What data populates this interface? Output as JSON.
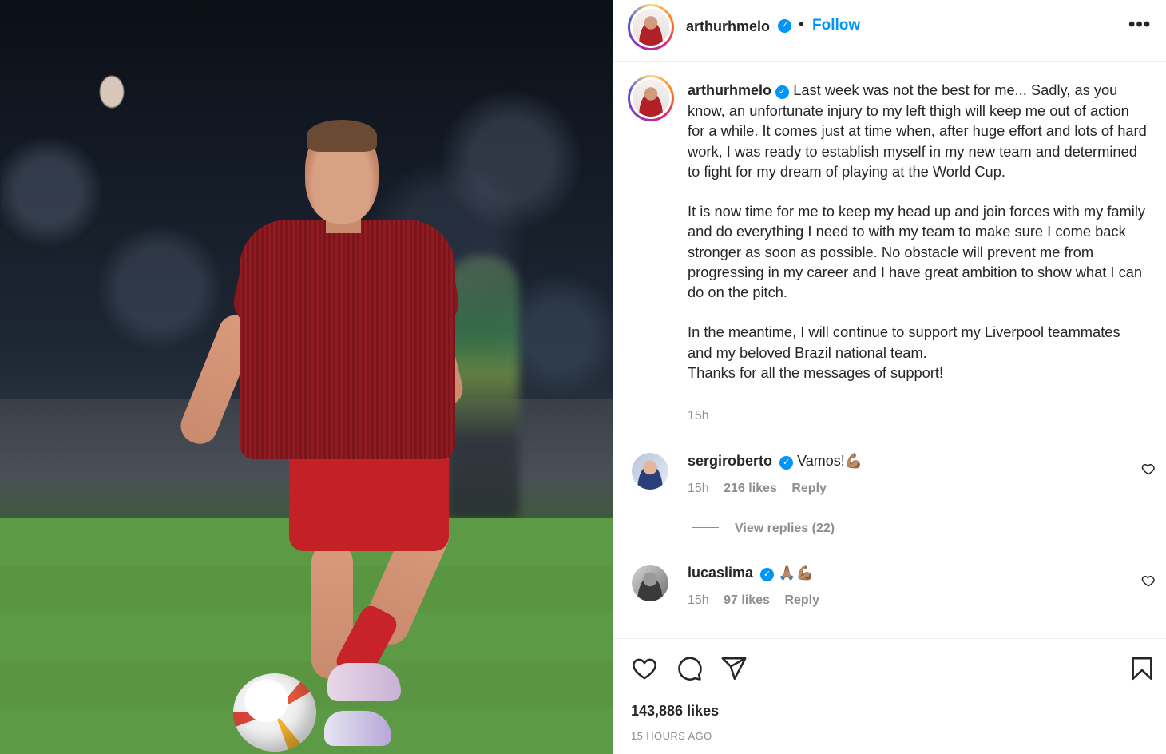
{
  "post": {
    "author": "arthurhmelo",
    "verified_mark": "✓",
    "separator": "•",
    "follow_label": "Follow",
    "more_label": "•••",
    "caption": "Last week was not the best for me... Sadly, as you know, an unfortunate injury to my left thigh will keep me out of action for a while. It comes just at time when, after huge effort and lots of hard work, I was ready to establish myself in my new team and determined to fight for my dream of playing at the World Cup.\n\nIt is now time for me to keep my head up and join forces with my family and do everything I need to with my team to make sure I come back stronger as soon as possible. No obstacle will prevent me from progressing in my career and I have great ambition to show what I can do on the pitch.\n\nIn the meantime, I will continue to support my Liverpool teammates and my beloved Brazil national team.\nThanks for all the messages of support!",
    "caption_time": "15h",
    "likes": "143,886 likes",
    "timestamp": "15 HOURS AGO"
  },
  "comments": [
    {
      "user": "sergiroberto",
      "text": "Vamos!",
      "emoji": "💪🏽",
      "time": "15h",
      "likes": "216 likes",
      "reply_label": "Reply"
    },
    {
      "user": "lucaslima",
      "text": "",
      "emoji": "🙏🏽💪🏽",
      "time": "15h",
      "likes": "97 likes",
      "reply_label": "Reply"
    }
  ],
  "view_replies": "View replies (22)",
  "icons": {
    "like": "heart-icon",
    "comment": "comment-icon",
    "share": "paper-plane-icon",
    "save": "bookmark-icon",
    "more": "more-options-icon"
  },
  "colors": {
    "link_blue": "#0095f6",
    "verified_blue": "#0095f6",
    "secondary_text": "#8e8e8e",
    "primary_text": "#262626"
  }
}
